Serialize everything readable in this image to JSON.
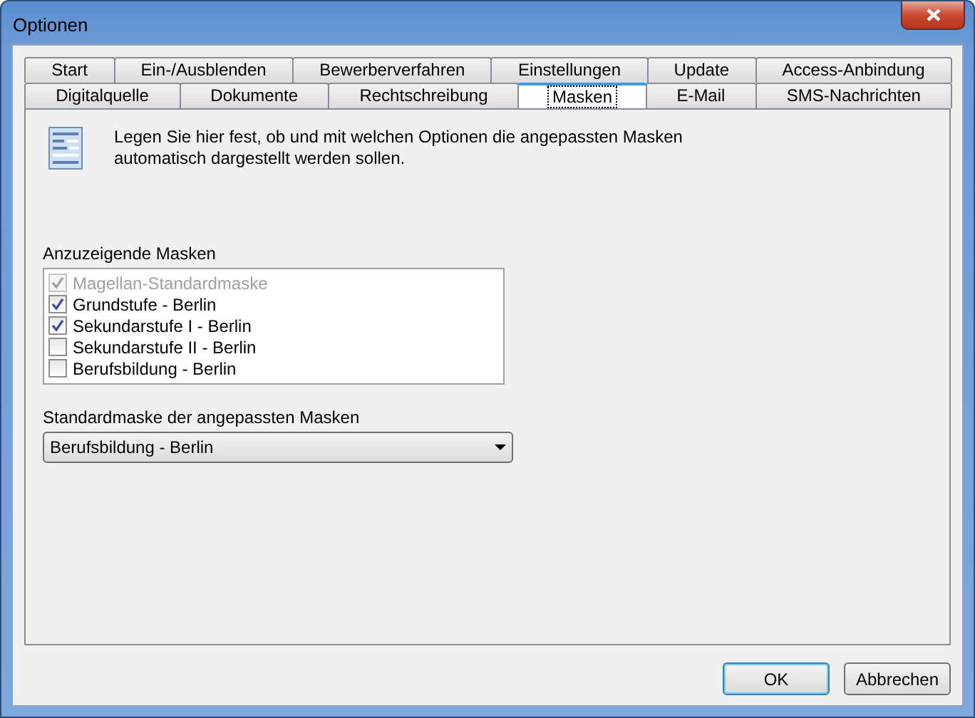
{
  "window": {
    "title": "Optionen"
  },
  "tab_rows": [
    [
      {
        "label": "Start",
        "selected": false
      },
      {
        "label": "Ein-/Ausblenden",
        "selected": false
      },
      {
        "label": "Bewerberverfahren",
        "selected": false
      },
      {
        "label": "Einstellungen",
        "selected": false
      },
      {
        "label": "Update",
        "selected": false
      },
      {
        "label": "Access-Anbindung",
        "selected": false
      }
    ],
    [
      {
        "label": "Digitalquelle",
        "selected": false
      },
      {
        "label": "Dokumente",
        "selected": false
      },
      {
        "label": "Rechtschreibung",
        "selected": false
      },
      {
        "label": "Masken",
        "selected": true
      },
      {
        "label": "E-Mail",
        "selected": false
      },
      {
        "label": "SMS-Nachrichten",
        "selected": false
      }
    ]
  ],
  "description": "Legen Sie hier fest, ob und mit welchen Optionen die angepassten Masken automatisch dargestellt werden sollen.",
  "masks": {
    "label": "Anzuzeigende Masken",
    "items": [
      {
        "label": "Magellan-Standardmaske",
        "checked": true,
        "disabled": true
      },
      {
        "label": "Grundstufe - Berlin",
        "checked": true,
        "disabled": false
      },
      {
        "label": "Sekundarstufe I - Berlin",
        "checked": true,
        "disabled": false
      },
      {
        "label": "Sekundarstufe II - Berlin",
        "checked": false,
        "disabled": false
      },
      {
        "label": "Berufsbildung - Berlin",
        "checked": false,
        "disabled": false
      }
    ]
  },
  "default_mask": {
    "label": "Standardmaske der angepassten Masken",
    "value": "Berufsbildung - Berlin"
  },
  "buttons": [
    {
      "label": "OK",
      "default": true
    },
    {
      "label": "Abbrechen",
      "default": false
    }
  ]
}
